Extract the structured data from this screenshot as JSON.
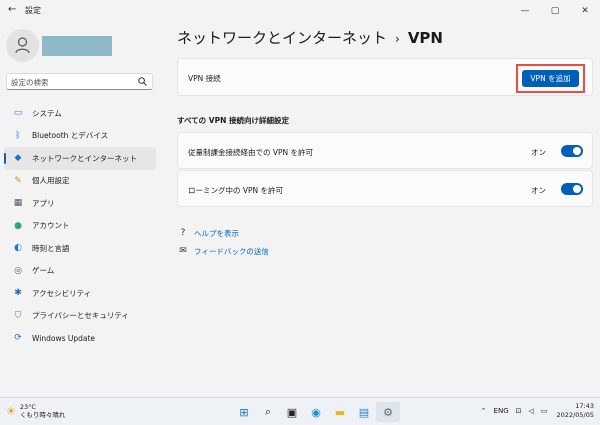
{
  "window": {
    "title": "設定"
  },
  "sidebar": {
    "search_placeholder": "設定の検索",
    "items": [
      {
        "label": "システム",
        "icon": "monitor-icon"
      },
      {
        "label": "Bluetooth とデバイス",
        "icon": "bluetooth-icon"
      },
      {
        "label": "ネットワークとインターネット",
        "icon": "wifi-icon",
        "active": true
      },
      {
        "label": "個人用設定",
        "icon": "brush-icon"
      },
      {
        "label": "アプリ",
        "icon": "apps-icon"
      },
      {
        "label": "アカウント",
        "icon": "person-icon"
      },
      {
        "label": "時刻と言語",
        "icon": "globe-clock-icon"
      },
      {
        "label": "ゲーム",
        "icon": "gamepad-icon"
      },
      {
        "label": "アクセシビリティ",
        "icon": "accessibility-icon"
      },
      {
        "label": "プライバシーとセキュリティ",
        "icon": "shield-icon"
      },
      {
        "label": "Windows Update",
        "icon": "update-icon"
      }
    ]
  },
  "header": {
    "parent": "ネットワークとインターネット",
    "current": "VPN"
  },
  "vpn_card": {
    "label": "VPN 接続",
    "add_button": "VPN を追加"
  },
  "advanced": {
    "title": "すべての VPN 接続向け詳細設定",
    "metered": {
      "label": "従量制課金接続経由での VPN を許可",
      "state": "オン"
    },
    "roaming": {
      "label": "ローミング中の VPN を許可",
      "state": "オン"
    }
  },
  "links": {
    "help": "ヘルプを表示",
    "feedback": "フィードバックの送信"
  },
  "taskbar": {
    "temperature": "23°C",
    "weather": "くもり時々晴れ",
    "language": "ENG",
    "time": "17:43",
    "date": "2022/05/05"
  },
  "colors": {
    "accent": "#005fb8",
    "highlight": "#ef4b43"
  }
}
